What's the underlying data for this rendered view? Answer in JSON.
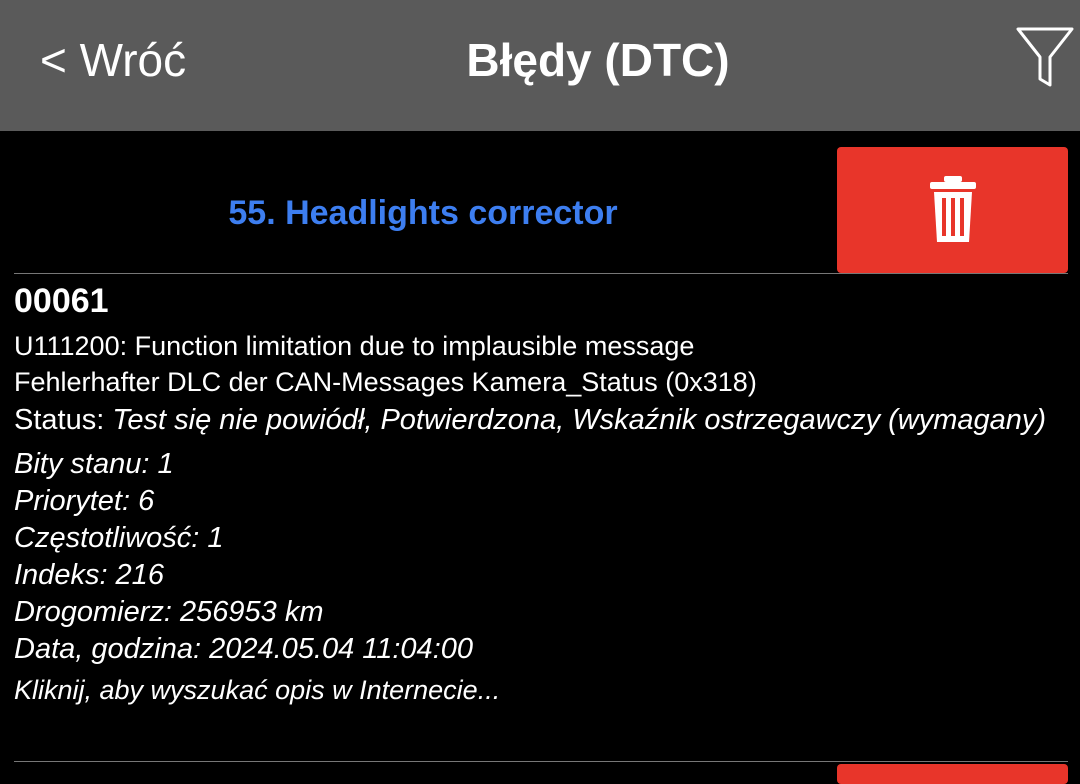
{
  "header": {
    "back_label": "< Wróć",
    "title": "Błędy (DTC)",
    "filter_icon": "filter-icon"
  },
  "module": {
    "name": "55. Headlights corrector",
    "delete_icon": "trash-icon",
    "delete_color": "#e8352a",
    "name_color": "#3d7ef0"
  },
  "dtc": {
    "code": "00061",
    "description_1": "U111200: Function limitation due to implausible message",
    "description_2": "Fehlerhafter DLC der CAN-Messages Kamera_Status (0x318)",
    "status_label": "Status: ",
    "status_value": "Test się nie powiódł, Potwierdzona, Wskaźnik ostrzegawczy (wymagany)",
    "status_bits": "Bity stanu: 1",
    "priority": "Priorytet: 6",
    "frequency": "Częstotliwość: 1",
    "index": "Indeks: 216",
    "odometer": "Drogomierz: 256953 km",
    "datetime": "Data, godzina: 2024.05.04 11:04:00",
    "search_link": "Kliknij, aby wyszukać opis w Internecie..."
  }
}
